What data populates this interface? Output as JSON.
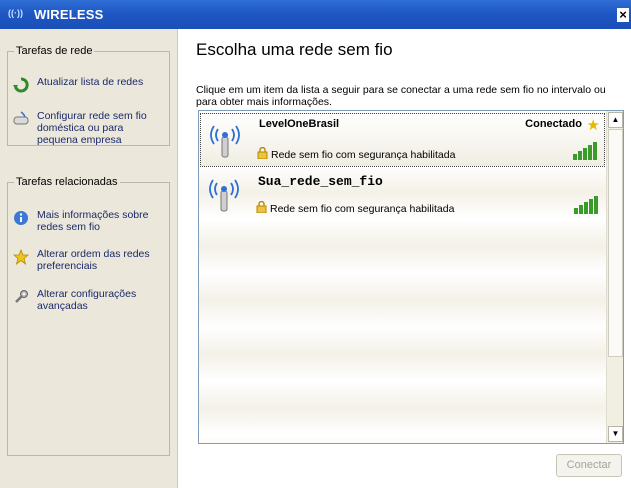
{
  "window": {
    "title": "WIRELESS",
    "title_icon": "((·))",
    "close_label": "×"
  },
  "sidebar": {
    "group1": {
      "title": "Tarefas de rede",
      "items": [
        {
          "icon": "refresh-icon",
          "label": "Atualizar lista de redes"
        },
        {
          "icon": "wizard-icon",
          "label": "Configurar rede sem fio doméstica ou para pequena empresa"
        }
      ]
    },
    "group2": {
      "title": "Tarefas relacionadas",
      "items": [
        {
          "icon": "info-icon",
          "label": "Mais informações sobre redes sem fio"
        },
        {
          "icon": "star-icon",
          "label": "Alterar ordem das redes preferenciais"
        },
        {
          "icon": "settings-icon",
          "label": "Alterar configurações avançadas"
        }
      ]
    }
  },
  "main": {
    "heading": "Escolha uma rede sem fio",
    "instructions": "Clique em um item da lista a seguir para se conectar a uma rede sem fio no intervalo ou para obter mais informações.",
    "networks": [
      {
        "name": "LevelOneBrasil",
        "status": "Conectado",
        "security": "Rede sem fio com segurança habilitada",
        "signal_bars": 5,
        "selected": true
      },
      {
        "name": "Sua_rede_sem_fio",
        "status": "",
        "security": "Rede sem fio com segurança habilitada",
        "signal_bars": 5,
        "selected": false
      }
    ],
    "connect_button": "Conectar"
  },
  "colors": {
    "titlebar": "#1f57c3",
    "signal": "#3a9a2a",
    "link": "#1b2a6b"
  }
}
